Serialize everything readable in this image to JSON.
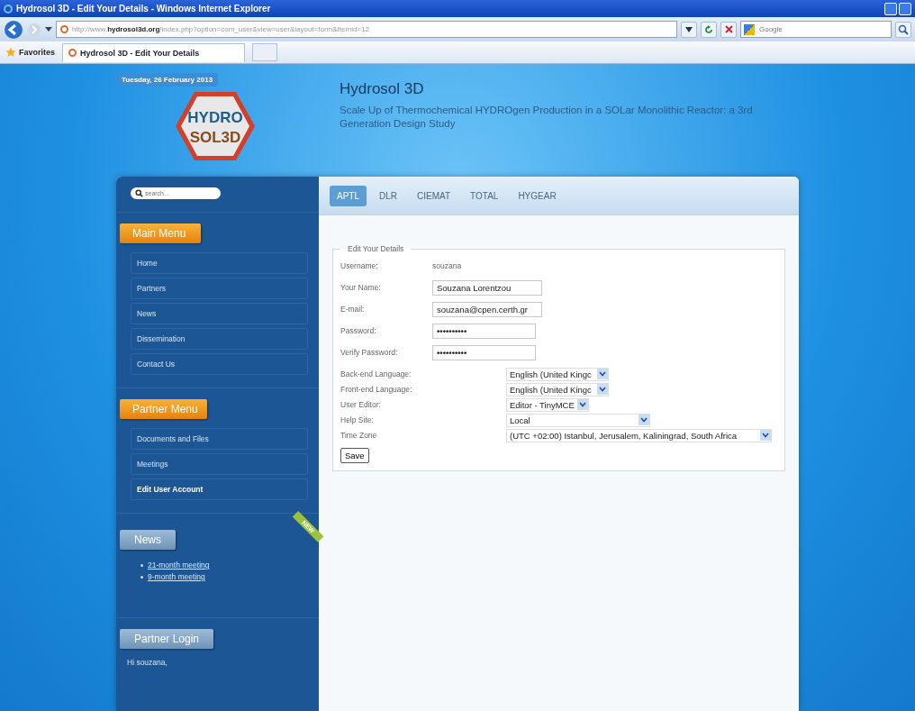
{
  "window": {
    "title": "Hydrosol 3D - Edit Your Details - Windows Internet Explorer"
  },
  "address_bar": {
    "prefix": "http://www.",
    "domain": "hydrosol3d.org",
    "path": "/index.php?option=com_user&view=user&layout=form&Itemid=12"
  },
  "search_box": {
    "placeholder": "Google"
  },
  "favorites": {
    "label": "Favorites"
  },
  "tabs": [
    {
      "label": "Hydrosol 3D - Edit Your Details",
      "selected": true
    }
  ],
  "site": {
    "date": "Tuesday, 26 February 2013",
    "logo_lines": [
      "HYDRO",
      "SOL3D"
    ],
    "title": "Hydrosol 3D",
    "subtitle": "Scale Up of Thermochemical HYDROgen Production in a SOLar Monolithic Reactor: a 3rd Generation Design Study"
  },
  "sidebar": {
    "search_placeholder": "search...",
    "main_menu": {
      "title": "Main Menu",
      "items": [
        {
          "label": "Home",
          "selected": false
        },
        {
          "label": "Partners",
          "selected": false
        },
        {
          "label": "News",
          "selected": false
        },
        {
          "label": "Dissemination",
          "selected": false
        },
        {
          "label": "Contact Us",
          "selected": false
        }
      ]
    },
    "partner_menu": {
      "title": "Partner Menu",
      "items": [
        {
          "label": "Documents and Files",
          "selected": false
        },
        {
          "label": "Meetings",
          "selected": false
        },
        {
          "label": "Edit User Account",
          "selected": true
        }
      ]
    },
    "news": {
      "title": "News",
      "ribbon": "NEW",
      "items": [
        "21-month meeting",
        "9-month meeting"
      ]
    },
    "partner_login": {
      "title": "Partner Login",
      "greeting": "Hi souzana,"
    }
  },
  "partner_tabs": [
    {
      "label": "APTL",
      "selected": true
    },
    {
      "label": "DLR",
      "selected": false
    },
    {
      "label": "CIEMAT",
      "selected": false
    },
    {
      "label": "TOTAL",
      "selected": false
    },
    {
      "label": "HYGEAR",
      "selected": false
    }
  ],
  "form": {
    "legend": "Edit Your Details",
    "fields": [
      {
        "kind": "static",
        "label": "Username:",
        "value": "souzana"
      },
      {
        "kind": "text",
        "label": "Your Name:",
        "value": "Souzana Lorentzou"
      },
      {
        "kind": "text",
        "label": "E-mail:",
        "value": "souzana@cpen.certh.gr"
      },
      {
        "kind": "password",
        "label": "Password:",
        "value": "••••••••••"
      },
      {
        "kind": "password",
        "label": "Verify Password:",
        "value": "••••••••••"
      }
    ],
    "params": [
      {
        "label": "Back-end Language:",
        "value": "English (United Kingc"
      },
      {
        "label": "Front-end Language:",
        "value": "English (United Kingc"
      },
      {
        "label": "User Editor:",
        "value": "Editor - TinyMCE"
      },
      {
        "label": "Help Site:",
        "value": "Local"
      },
      {
        "label": "Time Zone",
        "value": "(UTC +02:00) Istanbul, Jerusalem, Kaliningrad, South Africa"
      }
    ],
    "save_button": "Save"
  }
}
